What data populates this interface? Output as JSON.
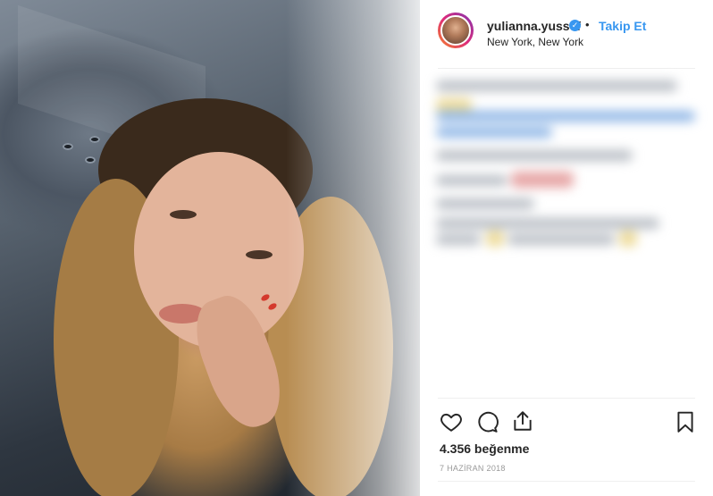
{
  "post": {
    "username": "yulianna.yussef",
    "follow_label": "Takip Et",
    "separator": "•",
    "location": "New York, New York",
    "likes_text": "4.356 beğenme",
    "date_text": "7 HAZİRAN 2018"
  },
  "colors": {
    "accent": "#3897f0",
    "text": "#262626",
    "muted": "#999999",
    "divider": "#efefef"
  },
  "icons": {
    "verified": "verified-badge-icon",
    "like": "heart-icon",
    "comment": "comment-icon",
    "share": "share-icon",
    "save": "bookmark-icon"
  }
}
